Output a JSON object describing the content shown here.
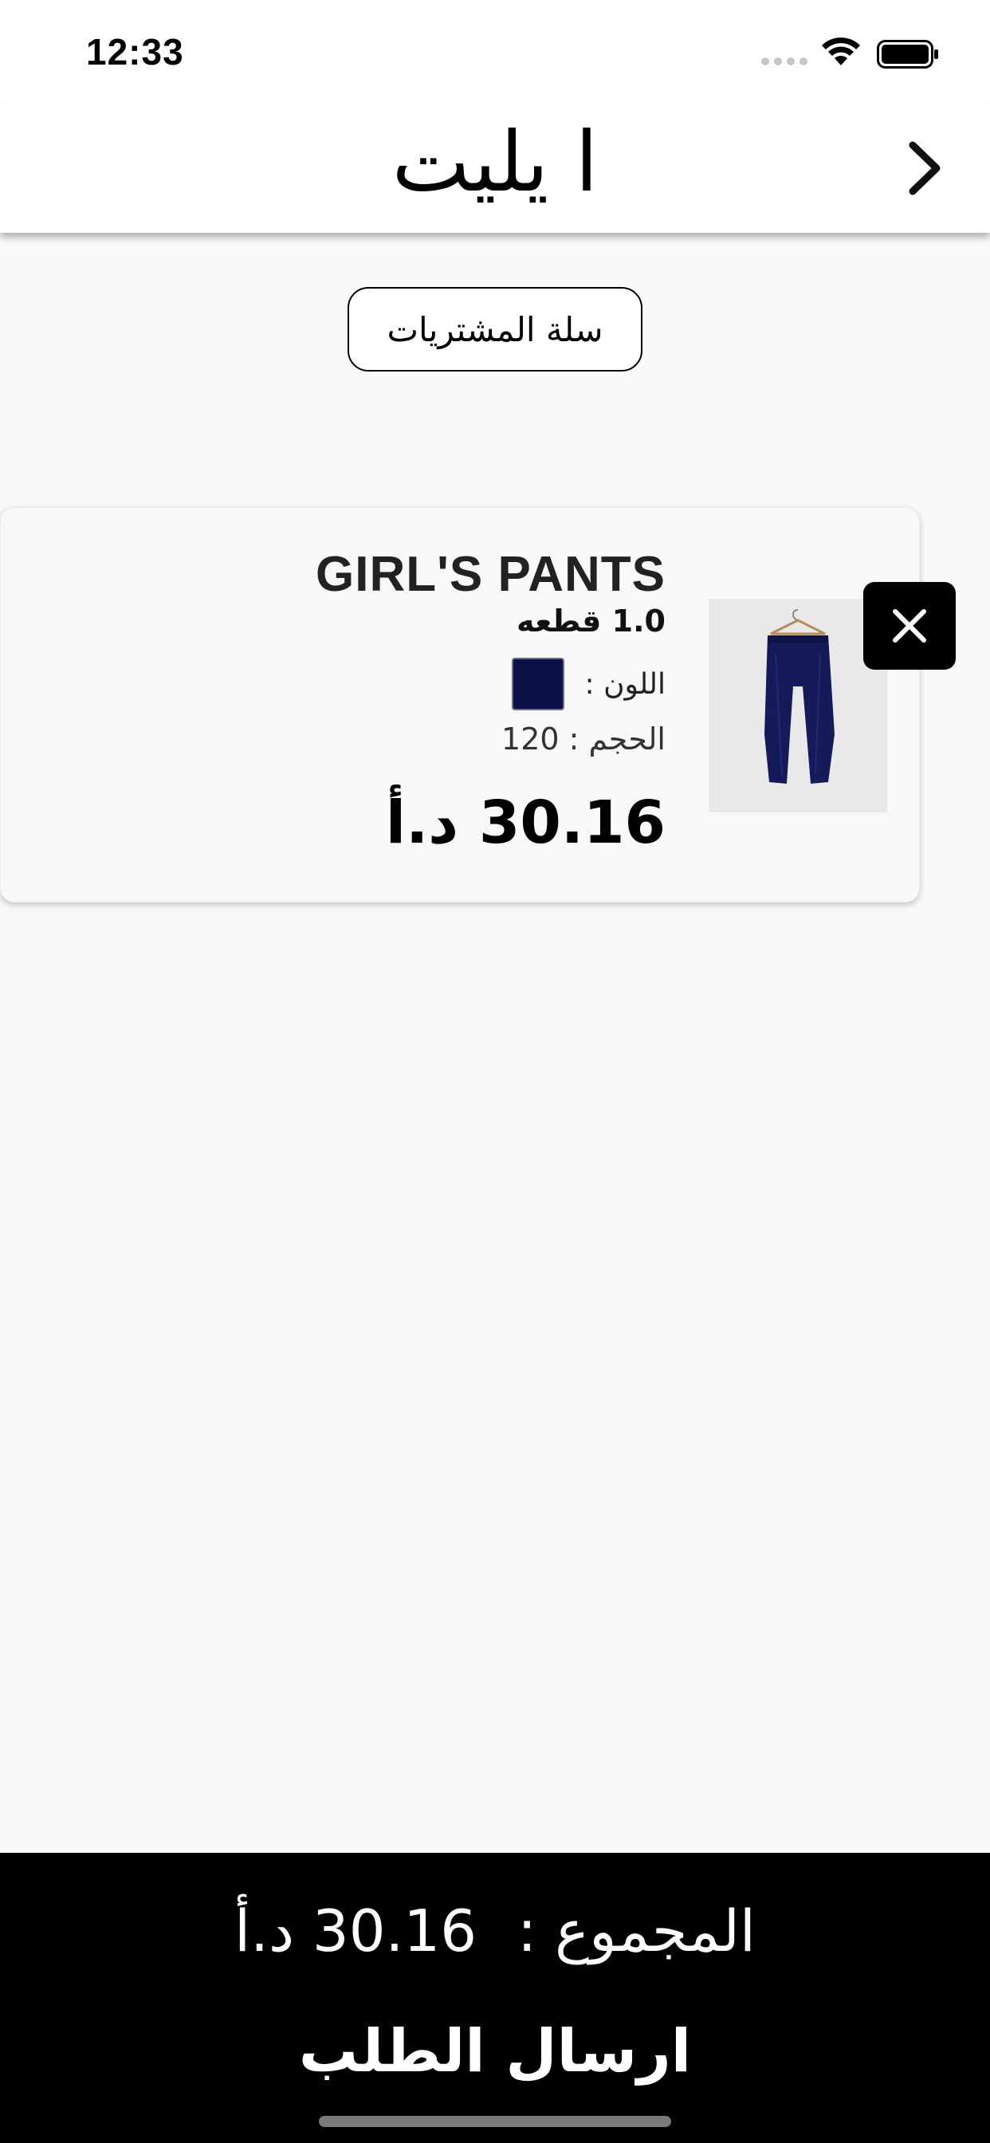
{
  "status_bar": {
    "time": "12:33"
  },
  "header": {
    "title": "ا يليت"
  },
  "cart": {
    "label": "سلة المشتريات"
  },
  "item": {
    "name": "GIRL'S  PANTS",
    "quantity": "1.0 قطعه",
    "color_label": "اللون :",
    "color_value": "#0b1147",
    "size_text": "الحجم : 120",
    "price": "30.16 د.أ"
  },
  "footer": {
    "total_label": "المجموع :",
    "total_value": "30.16 د.أ",
    "submit_label": "ارسال الطلب"
  }
}
